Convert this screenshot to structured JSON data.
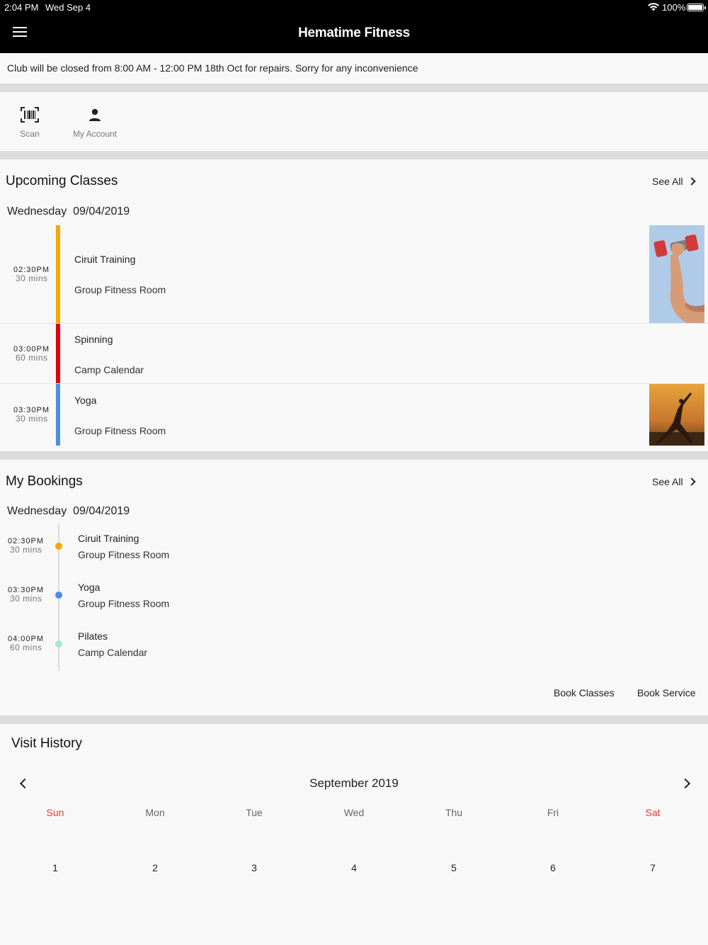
{
  "status_bar": {
    "time": "2:04 PM",
    "date": "Wed Sep 4",
    "battery": "100%"
  },
  "app": {
    "title": "Hematime Fitness"
  },
  "notice": "Club will be closed from 8:00 AM - 12:00 PM 18th Oct for repairs. Sorry for any inconvenience",
  "quick_actions": [
    {
      "label": "Scan",
      "icon": "barcode-scan-icon"
    },
    {
      "label": "My Account",
      "icon": "person-icon"
    }
  ],
  "upcoming": {
    "title": "Upcoming Classes",
    "see_all": "See All",
    "day": "Wednesday",
    "date": "09/04/2019",
    "classes": [
      {
        "time": "02:30PM",
        "duration": "30 mins",
        "name": "Ciruit Training",
        "room": "Group Fitness Room",
        "color": "#f5a800",
        "image": "dumbbell-arm"
      },
      {
        "time": "03:00PM",
        "duration": "60 mins",
        "name": "Spinning",
        "room": "Camp Calendar",
        "color": "#e3000b",
        "image": ""
      },
      {
        "time": "03:30PM",
        "duration": "30 mins",
        "name": "Yoga",
        "room": "Group Fitness Room",
        "color": "#4a90e2",
        "image": "yoga-sunset"
      }
    ]
  },
  "bookings": {
    "title": "My Bookings",
    "see_all": "See All",
    "day": "Wednesday",
    "date": "09/04/2019",
    "items": [
      {
        "time": "02:30PM",
        "duration": "30 mins",
        "name": "Ciruit Training",
        "room": "Group Fitness Room",
        "color": "#f5a800"
      },
      {
        "time": "03:30PM",
        "duration": "30 mins",
        "name": "Yoga",
        "room": "Group Fitness Room",
        "color": "#4a90e2"
      },
      {
        "time": "04:00PM",
        "duration": "60 mins",
        "name": "Pilates",
        "room": "Camp Calendar",
        "color": "#a8e6cf"
      }
    ],
    "actions": {
      "book_classes": "Book Classes",
      "book_service": "Book Service"
    }
  },
  "visit_history": {
    "title": "Visit History",
    "month": "September 2019",
    "weekdays": [
      "Sun",
      "Mon",
      "Tue",
      "Wed",
      "Thu",
      "Fri",
      "Sat"
    ],
    "days": [
      "1",
      "2",
      "3",
      "4",
      "5",
      "6",
      "7"
    ],
    "weekend_color": "#e53935"
  }
}
